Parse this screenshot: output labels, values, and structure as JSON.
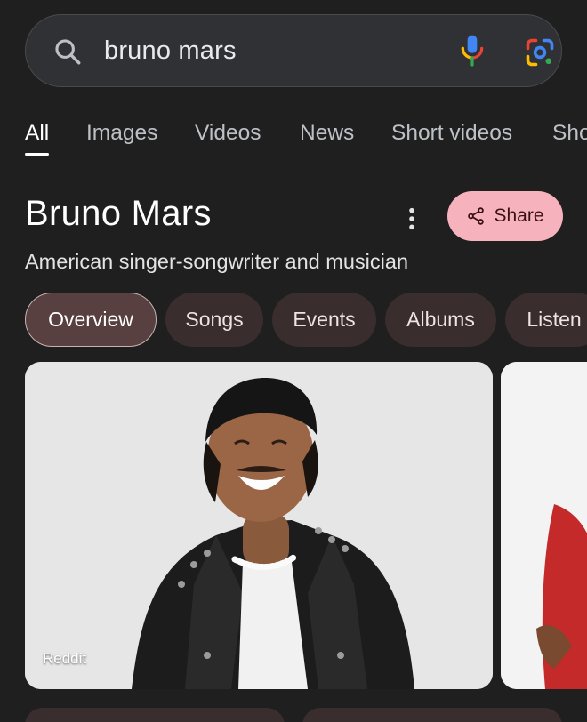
{
  "search": {
    "query": "bruno mars"
  },
  "tabs": [
    {
      "label": "All",
      "active": true
    },
    {
      "label": "Images"
    },
    {
      "label": "Videos"
    },
    {
      "label": "News"
    },
    {
      "label": "Short videos"
    },
    {
      "label": "Sho"
    }
  ],
  "entity": {
    "title": "Bruno Mars",
    "subtitle": "American singer-songwriter and musician",
    "share_label": "Share"
  },
  "chips": [
    {
      "label": "Overview",
      "active": true
    },
    {
      "label": "Songs"
    },
    {
      "label": "Events"
    },
    {
      "label": "Albums"
    },
    {
      "label": "Listen"
    }
  ],
  "images": [
    {
      "source": "Reddit"
    }
  ],
  "icons": {
    "search": "search-icon",
    "mic": "mic-icon",
    "lens": "google-lens-icon",
    "more": "more-vert-icon",
    "share": "share-icon"
  },
  "colors": {
    "background": "#1f1f1f",
    "search_bar": "#303134",
    "share_button": "#f7b3bd",
    "chip": "#3a2d2e",
    "chip_active": "#57403f"
  }
}
